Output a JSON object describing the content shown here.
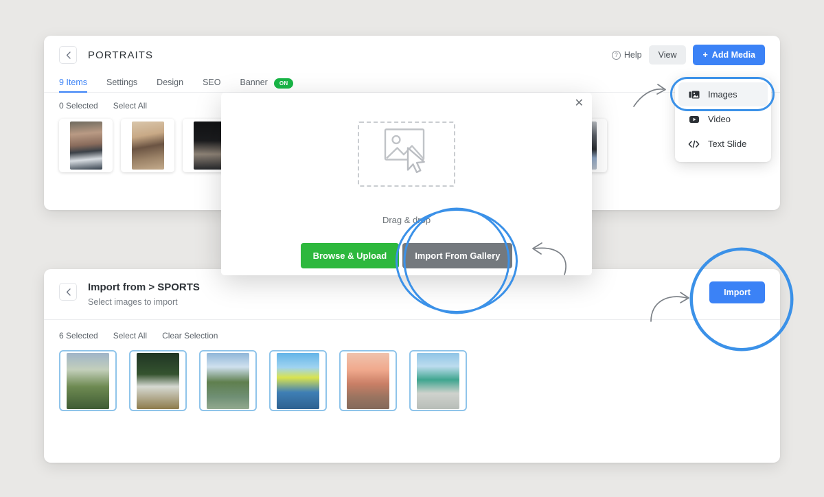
{
  "background_color": "#e9e8e6",
  "accent_blue": "#3b82f6",
  "accent_green": "#2db83d",
  "highlight_blue": "#3b91e8",
  "gallery_panel": {
    "back_icon": "chevron-left-icon",
    "title": "PORTRAITS",
    "help_label": "Help",
    "help_icon": "question-circle-icon",
    "view_label": "View",
    "add_media_label": "Add Media",
    "add_media_icon": "plus-icon",
    "tabs": [
      {
        "label": "9 Items",
        "active": true
      },
      {
        "label": "Settings",
        "active": false
      },
      {
        "label": "Design",
        "active": false
      },
      {
        "label": "SEO",
        "active": false
      },
      {
        "label": "Banner",
        "active": false
      }
    ],
    "banner_toggle": "ON",
    "selected_count_label": "0  Selected",
    "select_all_label": "Select All",
    "thumbnails": [
      {
        "name": "portrait-1",
        "swatch": "p1"
      },
      {
        "name": "portrait-2",
        "swatch": "p2"
      },
      {
        "name": "portrait-3",
        "swatch": "p3"
      },
      {
        "name": "portrait-4",
        "swatch": "p4"
      },
      {
        "name": "portrait-5",
        "swatch": "p5"
      }
    ]
  },
  "media_menu": {
    "items": [
      {
        "label": "Images",
        "icon": "images-stack-icon",
        "active": true
      },
      {
        "label": "Video",
        "icon": "video-play-icon",
        "active": false
      },
      {
        "label": "Text Slide",
        "icon": "code-brackets-icon",
        "active": false
      }
    ]
  },
  "upload_modal": {
    "close_icon": "close-x-icon",
    "dropzone_icon": "image-cursor-icon",
    "drag_text": "Drag & drop",
    "browse_label": "Browse & Upload",
    "gallery_label": "Import From Gallery"
  },
  "import_panel": {
    "back_icon": "chevron-left-icon",
    "title": "Import from > SPORTS",
    "subtitle": "Select images to import",
    "import_label": "Import",
    "selected_count_label": "6  Selected",
    "select_all_label": "Select All",
    "clear_selection_label": "Clear Selection",
    "thumbnails": [
      {
        "name": "sports-football-goalpost",
        "swatch": "s1"
      },
      {
        "name": "sports-quarterback",
        "swatch": "s2"
      },
      {
        "name": "sports-tennis",
        "swatch": "s3"
      },
      {
        "name": "sports-tennis-ball-court",
        "swatch": "s4"
      },
      {
        "name": "sports-beach-volleyball-serve",
        "swatch": "s5"
      },
      {
        "name": "sports-beach-volleyball-spike",
        "swatch": "s6"
      }
    ]
  },
  "annotations": {
    "highlight_menu": "images-menu-item-highlight",
    "highlight_gallery": "import-from-gallery-highlight",
    "highlight_import": "import-button-highlight",
    "arrow_to_menu": "arrow-pointing-right-to-menu",
    "arrow_to_gallery": "arrow-pointing-left-to-gallery-button",
    "arrow_to_import": "arrow-pointing-right-to-import-button"
  }
}
